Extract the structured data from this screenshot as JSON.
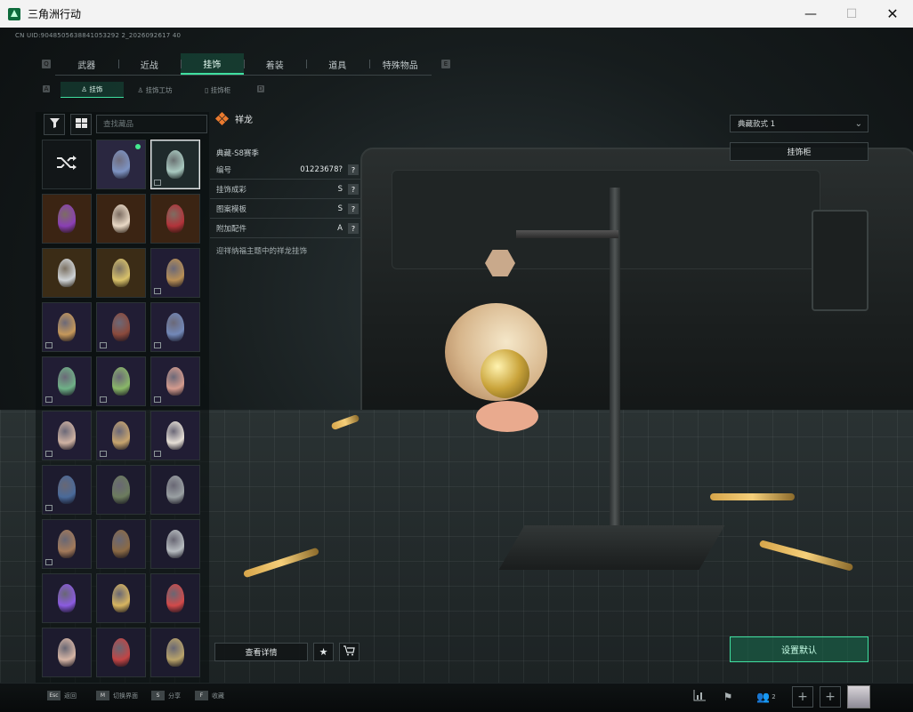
{
  "window": {
    "title": "三角洲行动",
    "minimize": "—",
    "maximize": "☐",
    "close": "✕"
  },
  "uid_text": "CN UID:9048505638841053292 2_2026092617 40",
  "main_tabs": [
    {
      "label": "武器",
      "active": false
    },
    {
      "label": "近战",
      "active": false
    },
    {
      "label": "挂饰",
      "active": true
    },
    {
      "label": "着装",
      "active": false
    },
    {
      "label": "道具",
      "active": false
    },
    {
      "label": "特殊物品",
      "active": false
    }
  ],
  "main_tabs_keys": {
    "left": "Q",
    "right": "E"
  },
  "sub_tabs": [
    {
      "label": "挂饰",
      "active": true
    },
    {
      "label": "挂饰工坊",
      "active": false
    },
    {
      "label": "挂饰柜",
      "active": false
    }
  ],
  "sub_tabs_keys": {
    "left": "A",
    "right": "D"
  },
  "search": {
    "placeholder": "查找藏品"
  },
  "grid_items": [
    {
      "kind": "shuffle",
      "color": "#121618"
    },
    {
      "kind": "item",
      "color": "#7d93c2",
      "bg": "#2a2740",
      "new": true
    },
    {
      "kind": "item",
      "color": "#a9c9c0",
      "bg": "#1f2a2b",
      "selected": true,
      "framed": true
    },
    {
      "kind": "item",
      "color": "#8a3fb5",
      "bg": "#3b2413"
    },
    {
      "kind": "item",
      "color": "#e9d9c6",
      "bg": "#3b2413"
    },
    {
      "kind": "item",
      "color": "#b2333a",
      "bg": "#3b2413"
    },
    {
      "kind": "item",
      "color": "#cfd3d6",
      "bg": "#3b2c16"
    },
    {
      "kind": "item",
      "color": "#d9c26a",
      "bg": "#3b2c16"
    },
    {
      "kind": "item",
      "color": "#b88f55",
      "bg": "#211d34",
      "framed": true
    },
    {
      "kind": "item",
      "color": "#c6985a",
      "bg": "#211d34",
      "framed": true
    },
    {
      "kind": "item",
      "color": "#8b4a3c",
      "bg": "#211d34",
      "framed": true
    },
    {
      "kind": "item",
      "color": "#7288b8",
      "bg": "#211d34",
      "framed": true
    },
    {
      "kind": "item",
      "color": "#6fb187",
      "bg": "#211d34",
      "framed": true
    },
    {
      "kind": "item",
      "color": "#8ab868",
      "bg": "#211d34",
      "framed": true
    },
    {
      "kind": "item",
      "color": "#d49b8e",
      "bg": "#211d34",
      "framed": true
    },
    {
      "kind": "item",
      "color": "#cfb2a2",
      "bg": "#211d34",
      "framed": true
    },
    {
      "kind": "item",
      "color": "#c7a46e",
      "bg": "#211d34",
      "framed": true
    },
    {
      "kind": "item",
      "color": "#e6dfd6",
      "bg": "#211d34",
      "framed": true
    },
    {
      "kind": "item",
      "color": "#4a6a9a",
      "bg": "#1d1b2e",
      "framed": true
    },
    {
      "kind": "item",
      "color": "#6c7c5e",
      "bg": "#1d1b2e"
    },
    {
      "kind": "item",
      "color": "#9aa0a3",
      "bg": "#1d1b2e"
    },
    {
      "kind": "item",
      "color": "#a37a5a",
      "bg": "#1d1b2e",
      "framed": true
    },
    {
      "kind": "item",
      "color": "#8b6a45",
      "bg": "#1d1b2e"
    },
    {
      "kind": "item",
      "color": "#b7bcc0",
      "bg": "#1d1b2e"
    },
    {
      "kind": "item",
      "color": "#8b5be0",
      "bg": "#1d1b2e"
    },
    {
      "kind": "item",
      "color": "#d8b560",
      "bg": "#1d1b2e"
    },
    {
      "kind": "item",
      "color": "#d24a4a",
      "bg": "#1d1b2e"
    },
    {
      "kind": "item",
      "color": "#d6b5a5",
      "bg": "#1d1b2e"
    },
    {
      "kind": "item",
      "color": "#c24545",
      "bg": "#1d1b2e"
    },
    {
      "kind": "item",
      "color": "#b9a36a",
      "bg": "#1d1b2e"
    }
  ],
  "detail": {
    "name": "祥龙",
    "season": "典藏-S8赛季",
    "attributes": [
      {
        "key": "编号",
        "value": "01223678?"
      },
      {
        "key": "挂饰成彩",
        "value": "S"
      },
      {
        "key": "图案模板",
        "value": "S"
      },
      {
        "key": "附加配件",
        "value": "A"
      }
    ],
    "help_mark": "?",
    "description": "迎祥纳福主题中的祥龙挂饰"
  },
  "style_select": {
    "label": "典藏款式 1"
  },
  "rack_button": "挂饰柜",
  "view_details": "查看详情",
  "set_default": "设置默认",
  "bottom_hints": [
    {
      "key": "Esc",
      "label": "返回"
    },
    {
      "key": "M",
      "label": "切换界面"
    },
    {
      "key": "S",
      "label": "分享"
    },
    {
      "key": "F",
      "label": "收藏"
    }
  ],
  "friends_count": "2",
  "colors": {
    "accent": "#3fe0a0",
    "brand": "#0d6b3c",
    "new_dot": "#44e88f",
    "rarity": "#ea7a2f"
  }
}
